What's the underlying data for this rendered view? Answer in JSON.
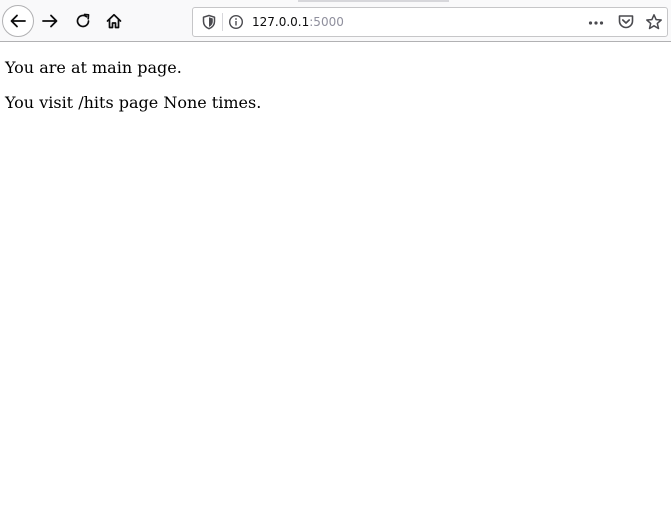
{
  "toolbar": {
    "back_icon": "arrow-left-icon",
    "forward_icon": "arrow-right-icon",
    "reload_icon": "reload-icon",
    "home_icon": "home-icon"
  },
  "urlbar": {
    "host": "127.0.0.1",
    "port": ":5000",
    "shield_icon": "tracking-protection-shield-icon",
    "info_icon": "site-info-icon",
    "page_actions_icon": "more-dots-icon",
    "pocket_icon": "pocket-icon",
    "bookmark_icon": "star-icon"
  },
  "page": {
    "line1": "You are at main page.",
    "line2": "You visit /hits page None times."
  },
  "colors": {
    "toolbar_bg": "#f9f9fa",
    "icon": "#0c0c0d",
    "url_port": "#8f8f9d"
  }
}
